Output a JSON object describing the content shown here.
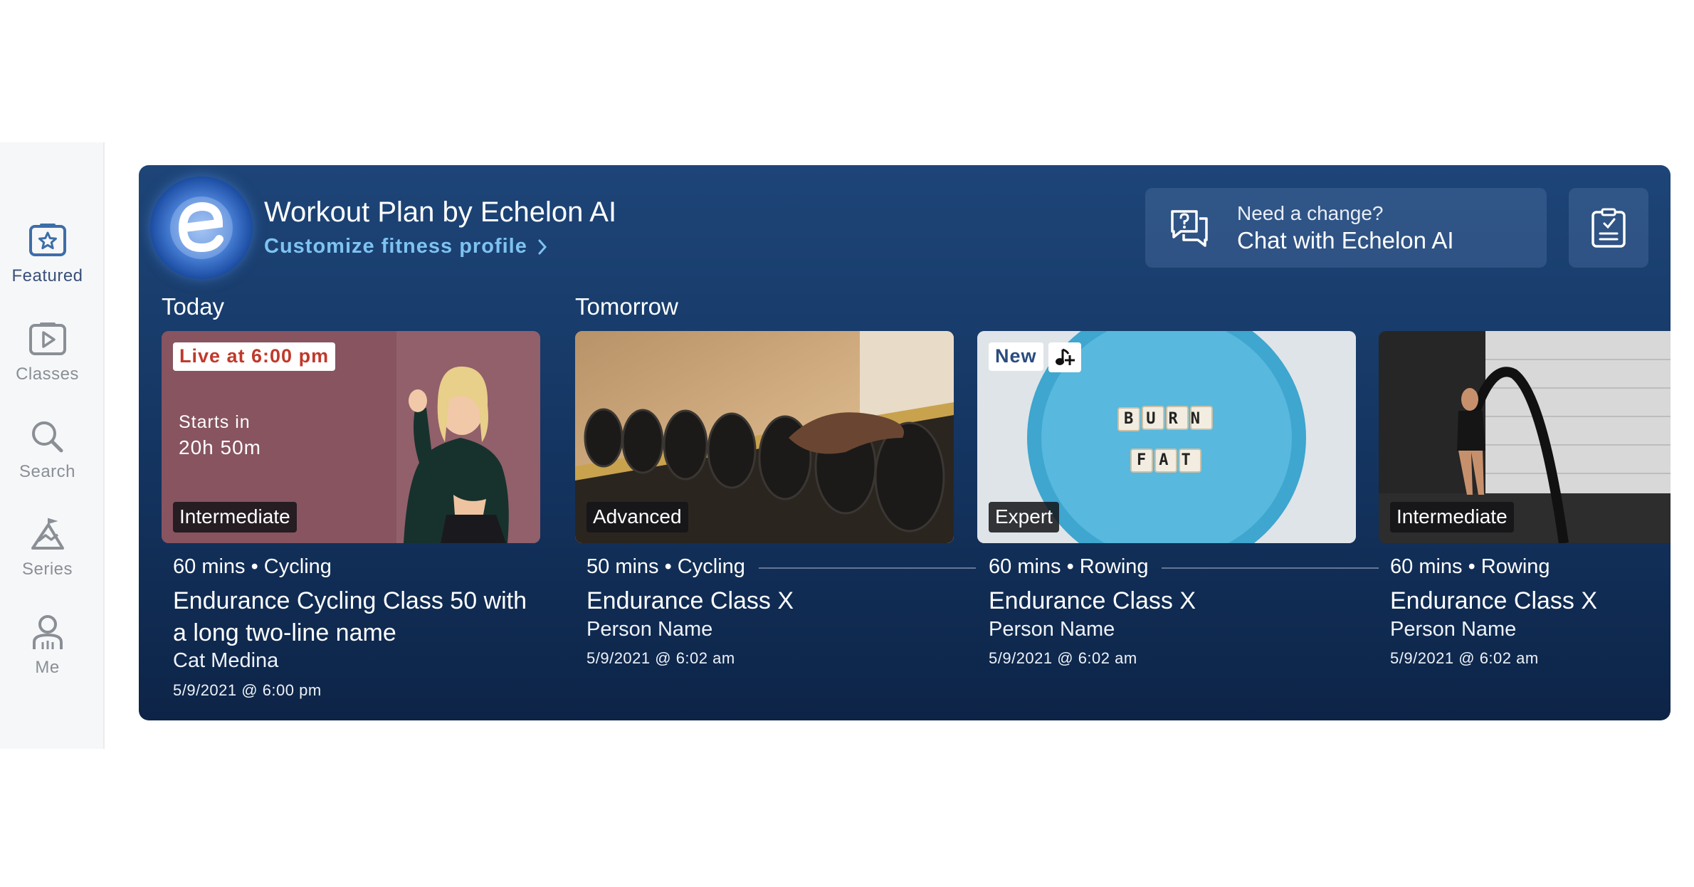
{
  "sidebar": {
    "items": [
      {
        "label": "Featured",
        "icon": "star-tv-icon",
        "active": true
      },
      {
        "label": "Classes",
        "icon": "play-icon",
        "active": false
      },
      {
        "label": "Search",
        "icon": "search-icon",
        "active": false
      },
      {
        "label": "Series",
        "icon": "series-icon",
        "active": false
      },
      {
        "label": "Me",
        "icon": "person-icon",
        "active": false
      }
    ]
  },
  "header": {
    "title": "Workout Plan by Echelon AI",
    "profile_link": "Customize fitness profile",
    "chat_sub": "Need a change?",
    "chat_main": "Chat with Echelon AI"
  },
  "days": {
    "today": "Today",
    "tomorrow": "Tomorrow"
  },
  "cards": [
    {
      "badge_top": "Live at 6:00 pm",
      "starts_label": "Starts in",
      "starts_value": "20h 50m",
      "level": "Intermediate",
      "duration": "60 mins",
      "type": "Cycling",
      "meta": "60 mins • Cycling",
      "title": "Endurance Cycling Class 50 with a long two-line name",
      "instructor": "Cat Medina",
      "date": "5/9/2021 @ 6:00 pm"
    },
    {
      "level": "Advanced",
      "meta": "50 mins • Cycling",
      "title": "Endurance Class X",
      "instructor": "Person Name",
      "date": "5/9/2021 @ 6:02 am"
    },
    {
      "badge_top": "New",
      "tiles_row1": "BURN",
      "tiles_row2": "FAT",
      "level": "Expert",
      "meta": "60 mins • Rowing",
      "title": "Endurance Class X",
      "instructor": "Person Name",
      "date": "5/9/2021 @ 6:02 am"
    },
    {
      "level": "Intermediate",
      "meta": "60 mins • Rowing",
      "title": "Endurance Class X",
      "instructor": "Person Name",
      "date": "5/9/2021 @ 6:02 am"
    }
  ],
  "colors": {
    "panel_top": "#1e4578",
    "panel_bottom": "#0d2447",
    "link": "#7ec3f2",
    "live_red": "#c0392b",
    "active_nav": "#3a4f7a"
  }
}
